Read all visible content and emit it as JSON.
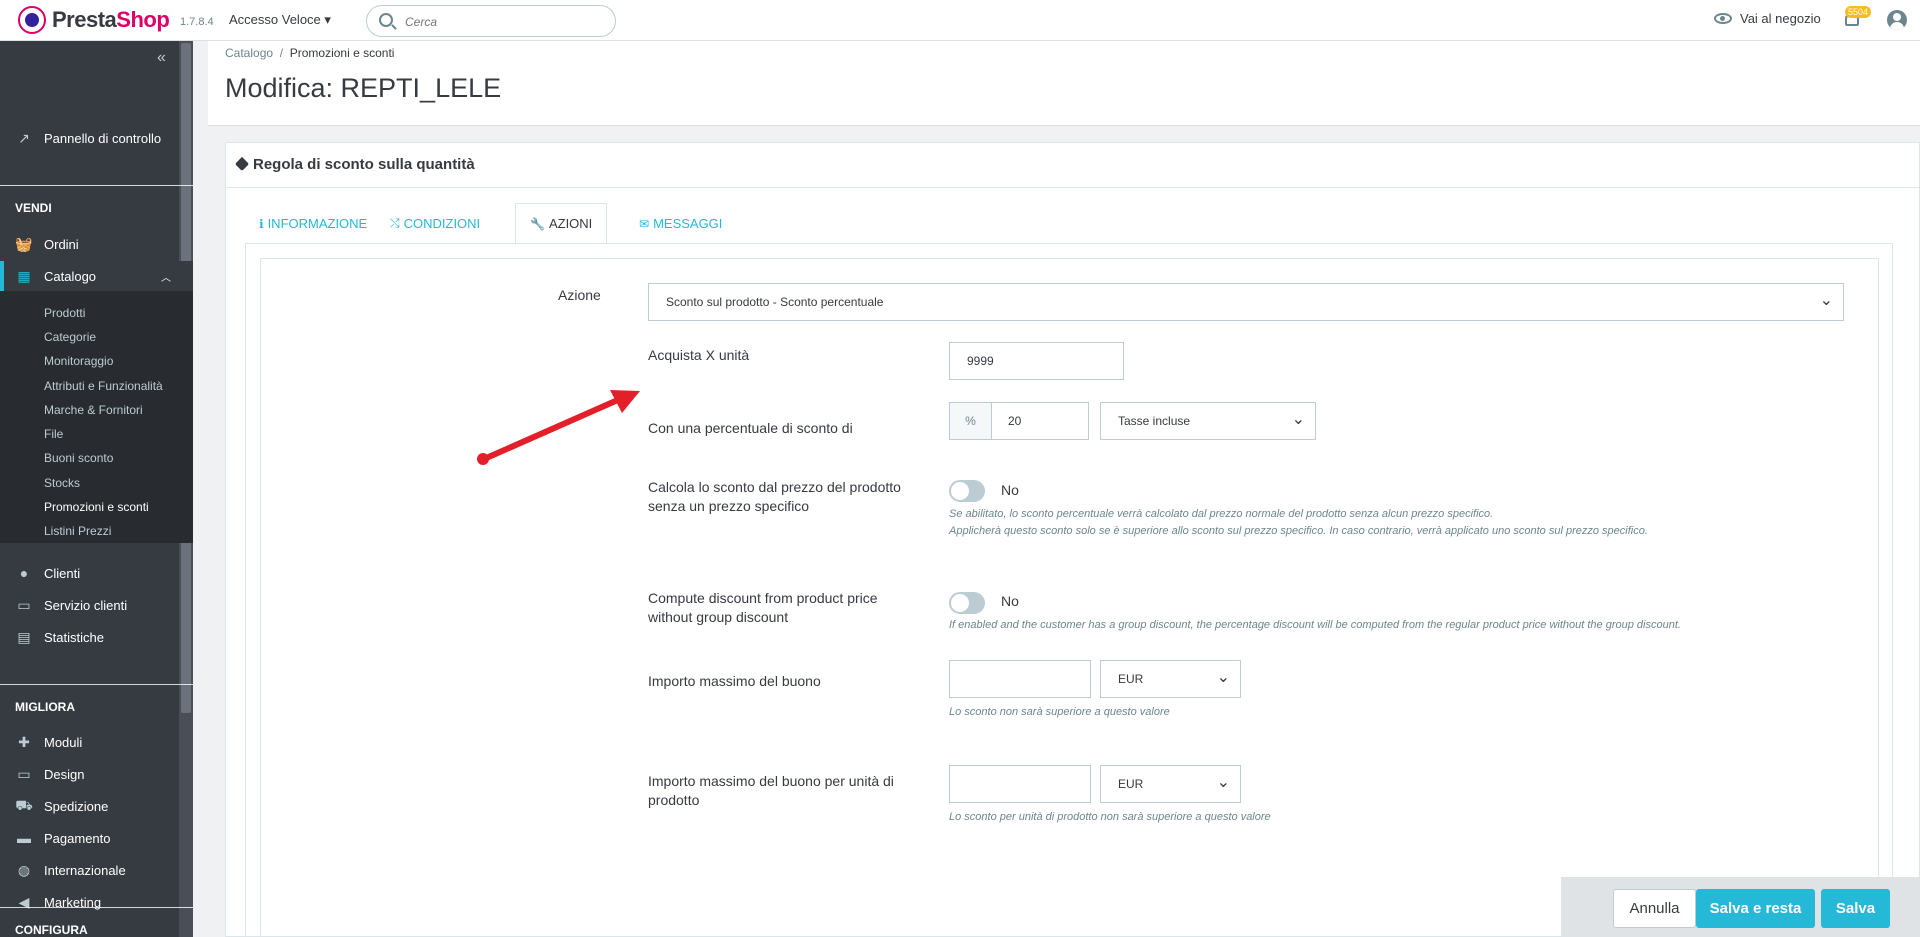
{
  "header": {
    "brand_part1": "Presta",
    "brand_part2": "Shop",
    "version": "1.7.8.4",
    "quick_access": "Accesso Veloce ▾",
    "search_placeholder": "Cerca",
    "view_shop": "Vai al negozio",
    "notifications_count": "5504"
  },
  "sidebar": {
    "collapse_label": "«",
    "dashboard": "Pannello di controllo",
    "sections": {
      "sell": "VENDI",
      "improve": "MIGLIORA",
      "configure": "CONFIGURA"
    },
    "sell_items": [
      "Ordini",
      "Catalogo",
      "Clienti",
      "Servizio clienti",
      "Statistiche"
    ],
    "catalog_sub": [
      "Prodotti",
      "Categorie",
      "Monitoraggio",
      "Attributi e Funzionalità",
      "Marche & Fornitori",
      "File",
      "Buoni sconto",
      "Stocks",
      "Promozioni e sconti",
      "Listini Prezzi"
    ],
    "improve_items": [
      "Moduli",
      "Design",
      "Spedizione",
      "Pagamento",
      "Internazionale",
      "Marketing"
    ]
  },
  "page": {
    "breadcrumb_parent": "Catalogo",
    "breadcrumb_sep": "/",
    "breadcrumb_current": "Promozioni e sconti",
    "title": "Modifica: REPTI_LELE"
  },
  "panel": {
    "title": "Regola di sconto sulla quantità",
    "tabs": [
      "INFORMAZIONE",
      "CONDIZIONI",
      "AZIONI",
      "MESSAGGI"
    ]
  },
  "form": {
    "action_label": "Azione",
    "action_value": "Sconto sul prodotto - Sconto percentuale",
    "buy_label": "Acquista X unità",
    "buy_value": "9999",
    "percent_label": "Con una percentuale di sconto di",
    "percent_symbol": "%",
    "percent_value": "20",
    "tax_value": "Tasse incluse",
    "calc_label": "Calcola lo sconto dal prezzo del prodotto senza un prezzo specifico",
    "calc_state": "No",
    "calc_help1": "Se abilitato, lo sconto percentuale verrà calcolato dal prezzo normale del prodotto senza alcun prezzo specifico.",
    "calc_help2": "Applicherà questo sconto solo se è superiore allo sconto sul prezzo specifico. In caso contrario, verrà applicato uno sconto sul prezzo specifico.",
    "group_label": "Compute discount from product price without group discount",
    "group_state": "No",
    "group_help": "If enabled and the customer has a group discount, the percentage discount will be computed from the regular product price without the group discount.",
    "max_label": "Importo massimo del buono",
    "max_currency": "EUR",
    "max_help": "Lo sconto non sarà superiore a questo valore",
    "max_unit_label": "Importo massimo del buono per unità di prodotto",
    "max_unit_currency": "EUR",
    "max_unit_help": "Lo sconto per unità di prodotto non sarà superiore a questo valore"
  },
  "footer": {
    "cancel": "Annulla",
    "save_stay": "Salva e resta",
    "save": "Salva"
  },
  "colors": {
    "accent": "#25b9d7",
    "brand_pink": "#df0067",
    "sidebar_bg": "#363a41",
    "arrow_red": "#e3202a"
  }
}
